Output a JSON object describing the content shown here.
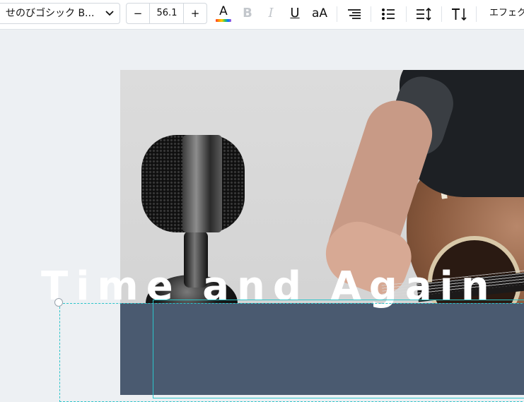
{
  "toolbar": {
    "font_family": "せのびゴシック B...",
    "font_size": "56.1",
    "minus_label": "−",
    "plus_label": "+",
    "text_color_label": "A",
    "bold_label": "B",
    "italic_label": "I",
    "underline_label": "U",
    "case_label": "aA",
    "effects_label": "エフェク",
    "icons": [
      "chevron-down-icon",
      "text-color-icon",
      "bold-icon",
      "italic-icon",
      "underline-icon",
      "letter-case-icon",
      "align-right-icon",
      "list-icon",
      "line-spacing-icon",
      "text-direction-icon"
    ]
  },
  "canvas": {
    "title_text": "Time and Again",
    "text_band_color": "#4a5a70",
    "selection_color": "#2bc4c9"
  }
}
